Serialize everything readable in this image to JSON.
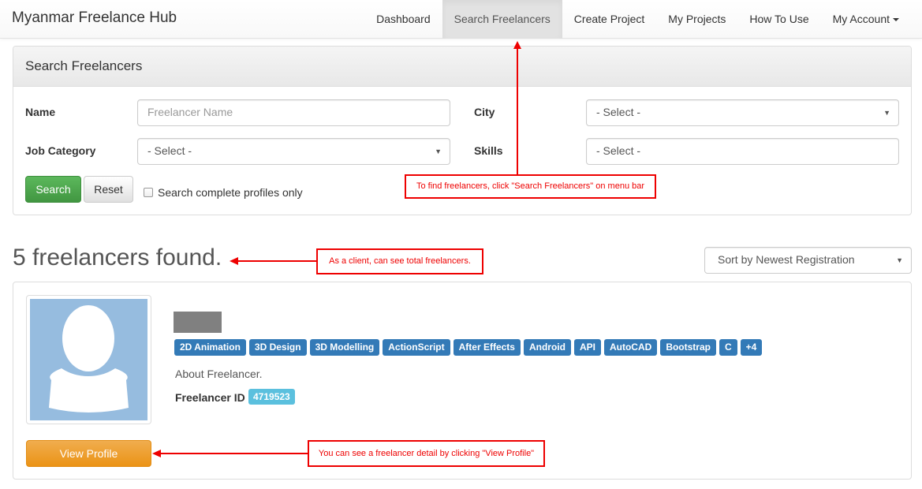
{
  "navbar": {
    "brand": "Myanmar Freelance Hub",
    "items": [
      {
        "label": "Dashboard"
      },
      {
        "label": "Search Freelancers"
      },
      {
        "label": "Create Project"
      },
      {
        "label": "My Projects"
      },
      {
        "label": "How To Use"
      },
      {
        "label": "My Account"
      }
    ],
    "active": "Search Freelancers"
  },
  "search_panel": {
    "title": "Search Freelancers",
    "name_label": "Name",
    "name_placeholder": "Freelancer Name",
    "city_label": "City",
    "city_value": "- Select -",
    "job_category_label": "Job Category",
    "job_category_value": "- Select -",
    "skills_label": "Skills",
    "skills_placeholder": "- Select -",
    "search_button": "Search",
    "reset_button": "Reset",
    "complete_only_label": "Search complete profiles only",
    "complete_only_checked": false
  },
  "results": {
    "found_text": "5 freelancers found.",
    "sort_value": "Sort by Newest Registration",
    "freelancers": [
      {
        "skills": [
          "2D Animation",
          "3D Design",
          "3D Modelling",
          "ActionScript",
          "After Effects",
          "Android",
          "API",
          "AutoCAD",
          "Bootstrap",
          "C",
          "+4"
        ],
        "about": "About Freelancer.",
        "id_label": "Freelancer ID",
        "id": "4719523",
        "view_button": "View Profile"
      }
    ]
  },
  "annotations": {
    "menu": "To find freelancers, click \"Search Freelancers\" on menu bar",
    "total": "As a client, can see total freelancers.",
    "view": "You can see a freelancer detail by clicking \"View Profile\""
  },
  "colors": {
    "primary": "#337ab7",
    "success": "#5cb85c",
    "warning": "#f0ad4e",
    "info": "#5bc0de",
    "annotation": "#ee0000"
  }
}
